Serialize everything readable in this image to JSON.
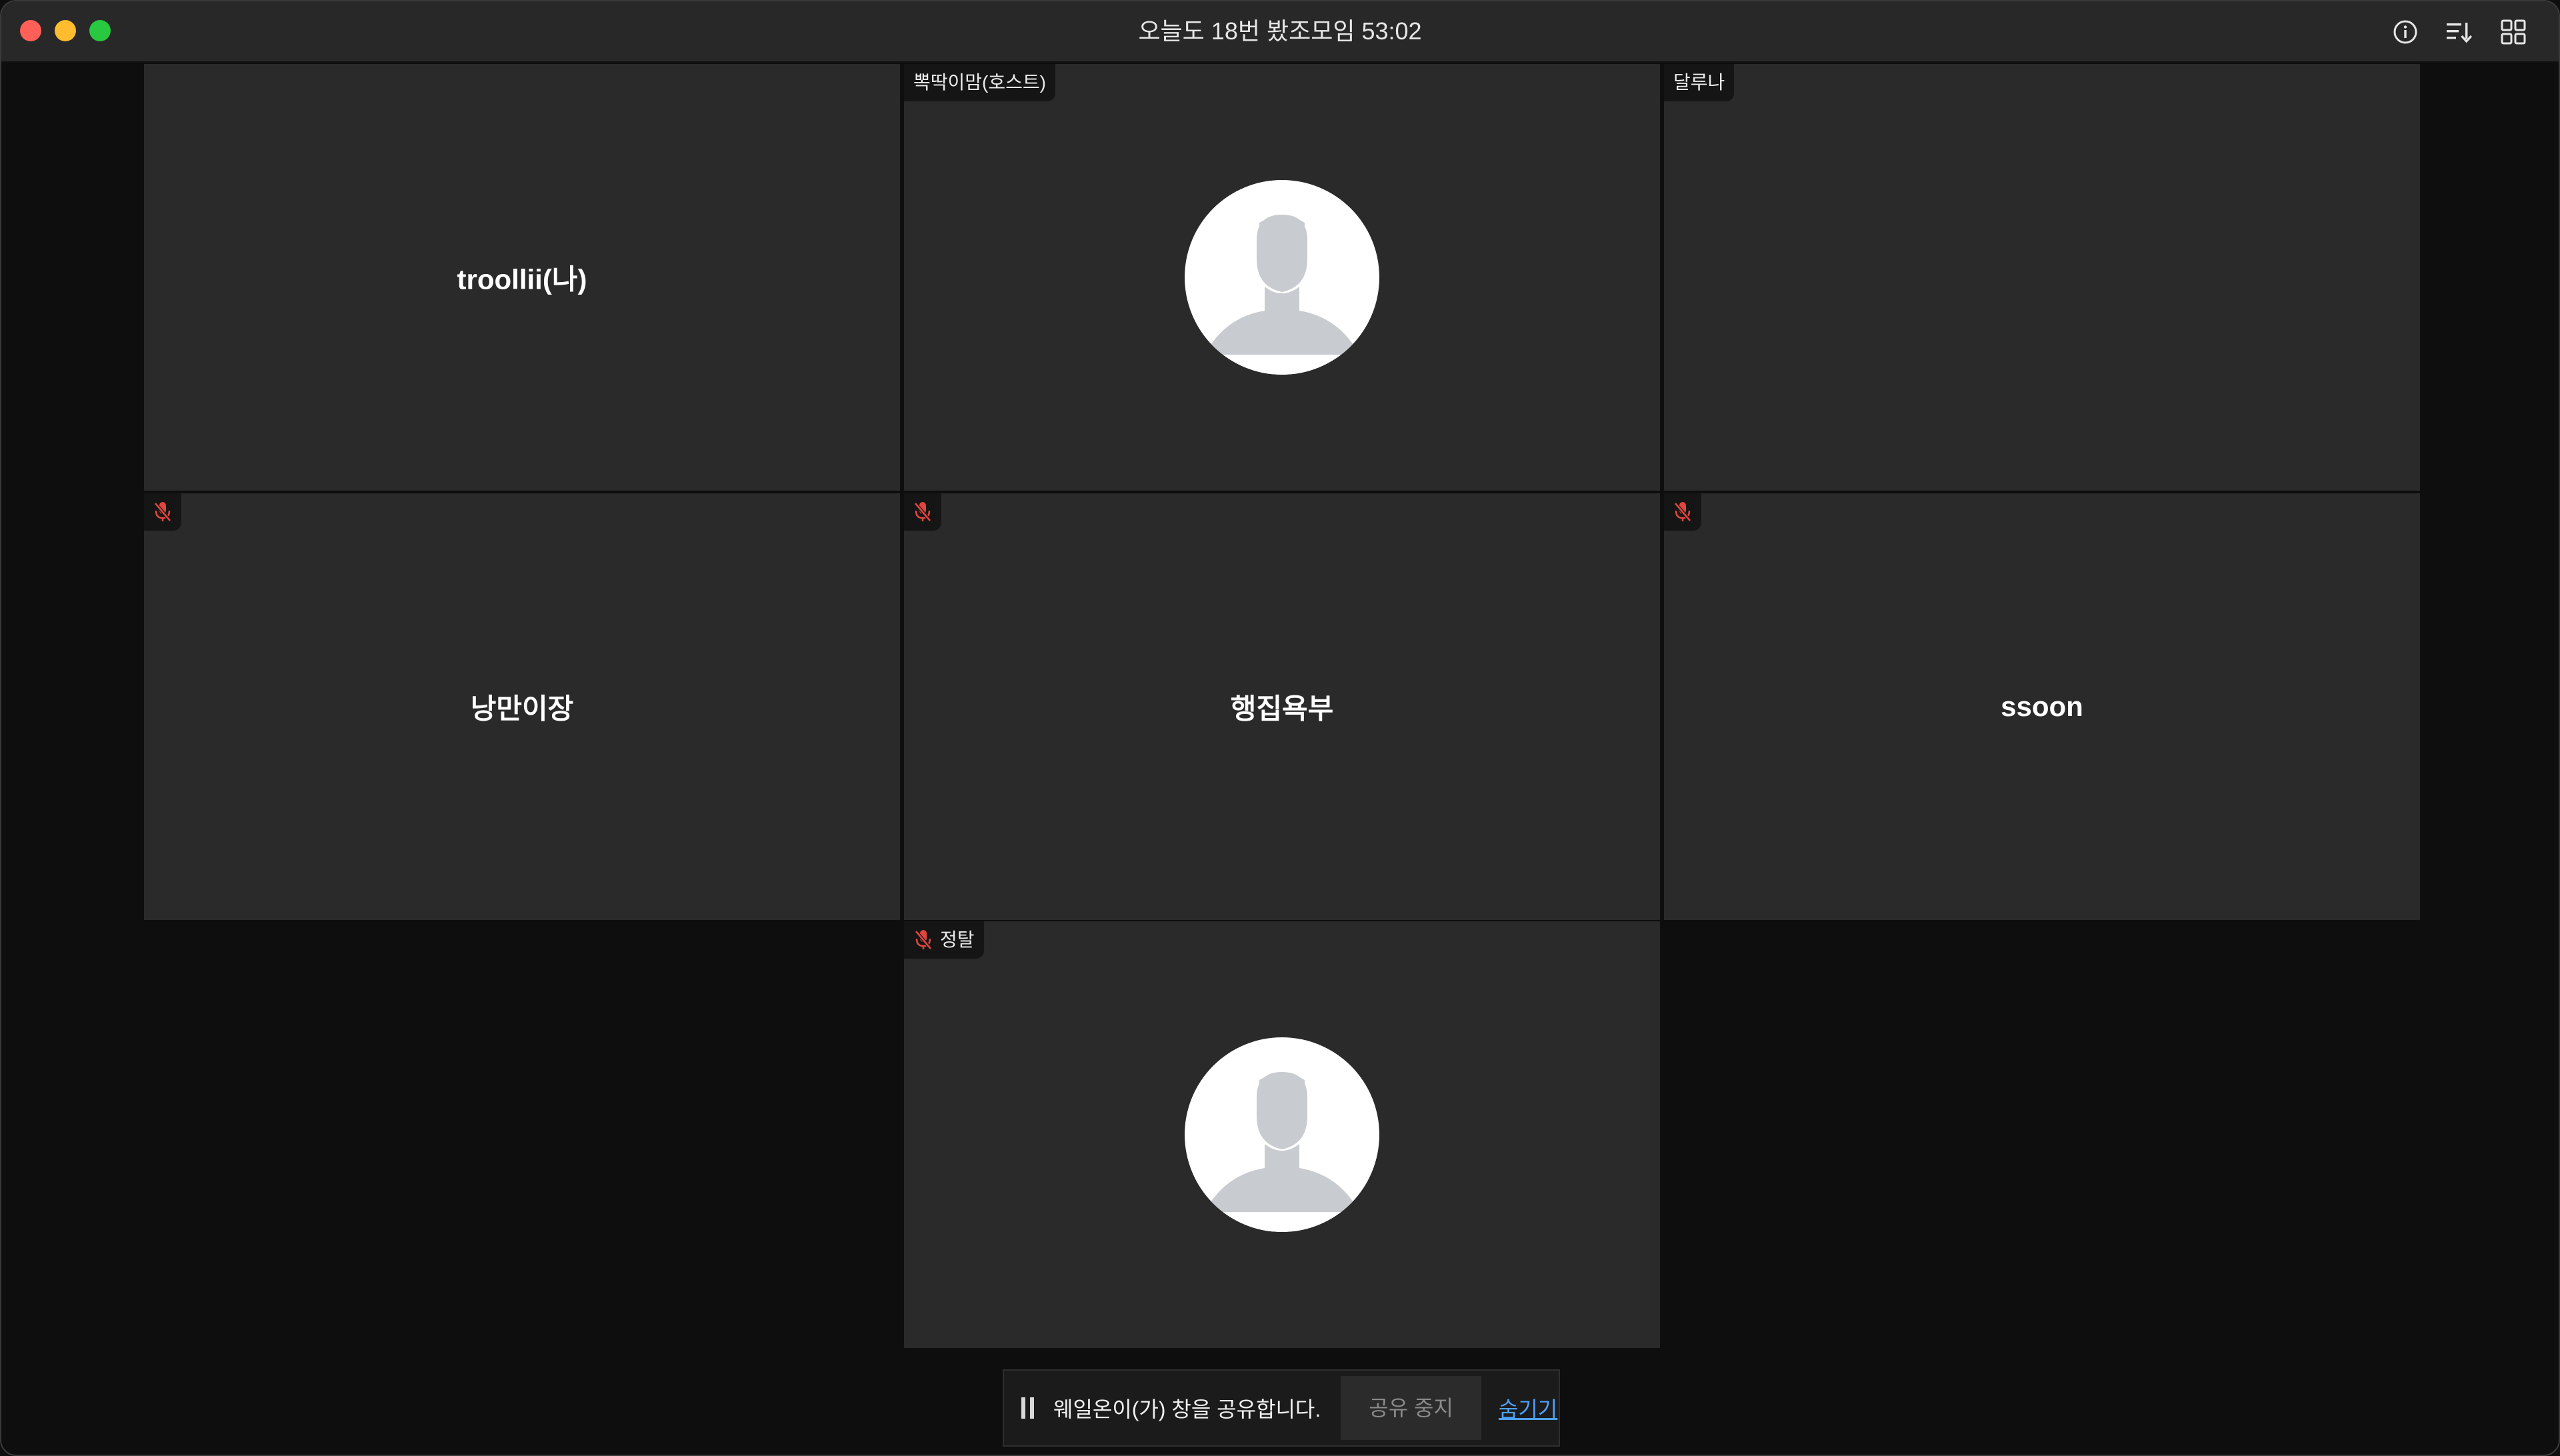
{
  "window": {
    "title": "오늘도 18번 봤조모임 53:02",
    "toolbar_icons": [
      "info-icon",
      "sort-icon",
      "grid-view-icon"
    ]
  },
  "participants": [
    {
      "name": "troollii(나)",
      "label": "",
      "muted": false,
      "avatar": false
    },
    {
      "name": "",
      "label": "뽁딱이맘(호스트)",
      "muted": false,
      "avatar": true
    },
    {
      "name": "",
      "label": "달루나",
      "muted": false,
      "avatar": false
    },
    {
      "name": "낭만이장",
      "label": "",
      "muted": true,
      "avatar": false
    },
    {
      "name": "행집욕부",
      "label": "",
      "muted": true,
      "avatar": false
    },
    {
      "name": "ssoon",
      "label": "",
      "muted": true,
      "avatar": false
    },
    {
      "name": "",
      "label": "정탈",
      "muted": true,
      "avatar": true
    }
  ],
  "share_bar": {
    "message": "웨일온이(가) 창을 공유합니다.",
    "stop_label": "공유 중지",
    "hide_label": "숨기기"
  },
  "colors": {
    "muted_mic": "#e0463f",
    "link": "#4ea1ff",
    "tile_bg": "#2a2a2a"
  }
}
